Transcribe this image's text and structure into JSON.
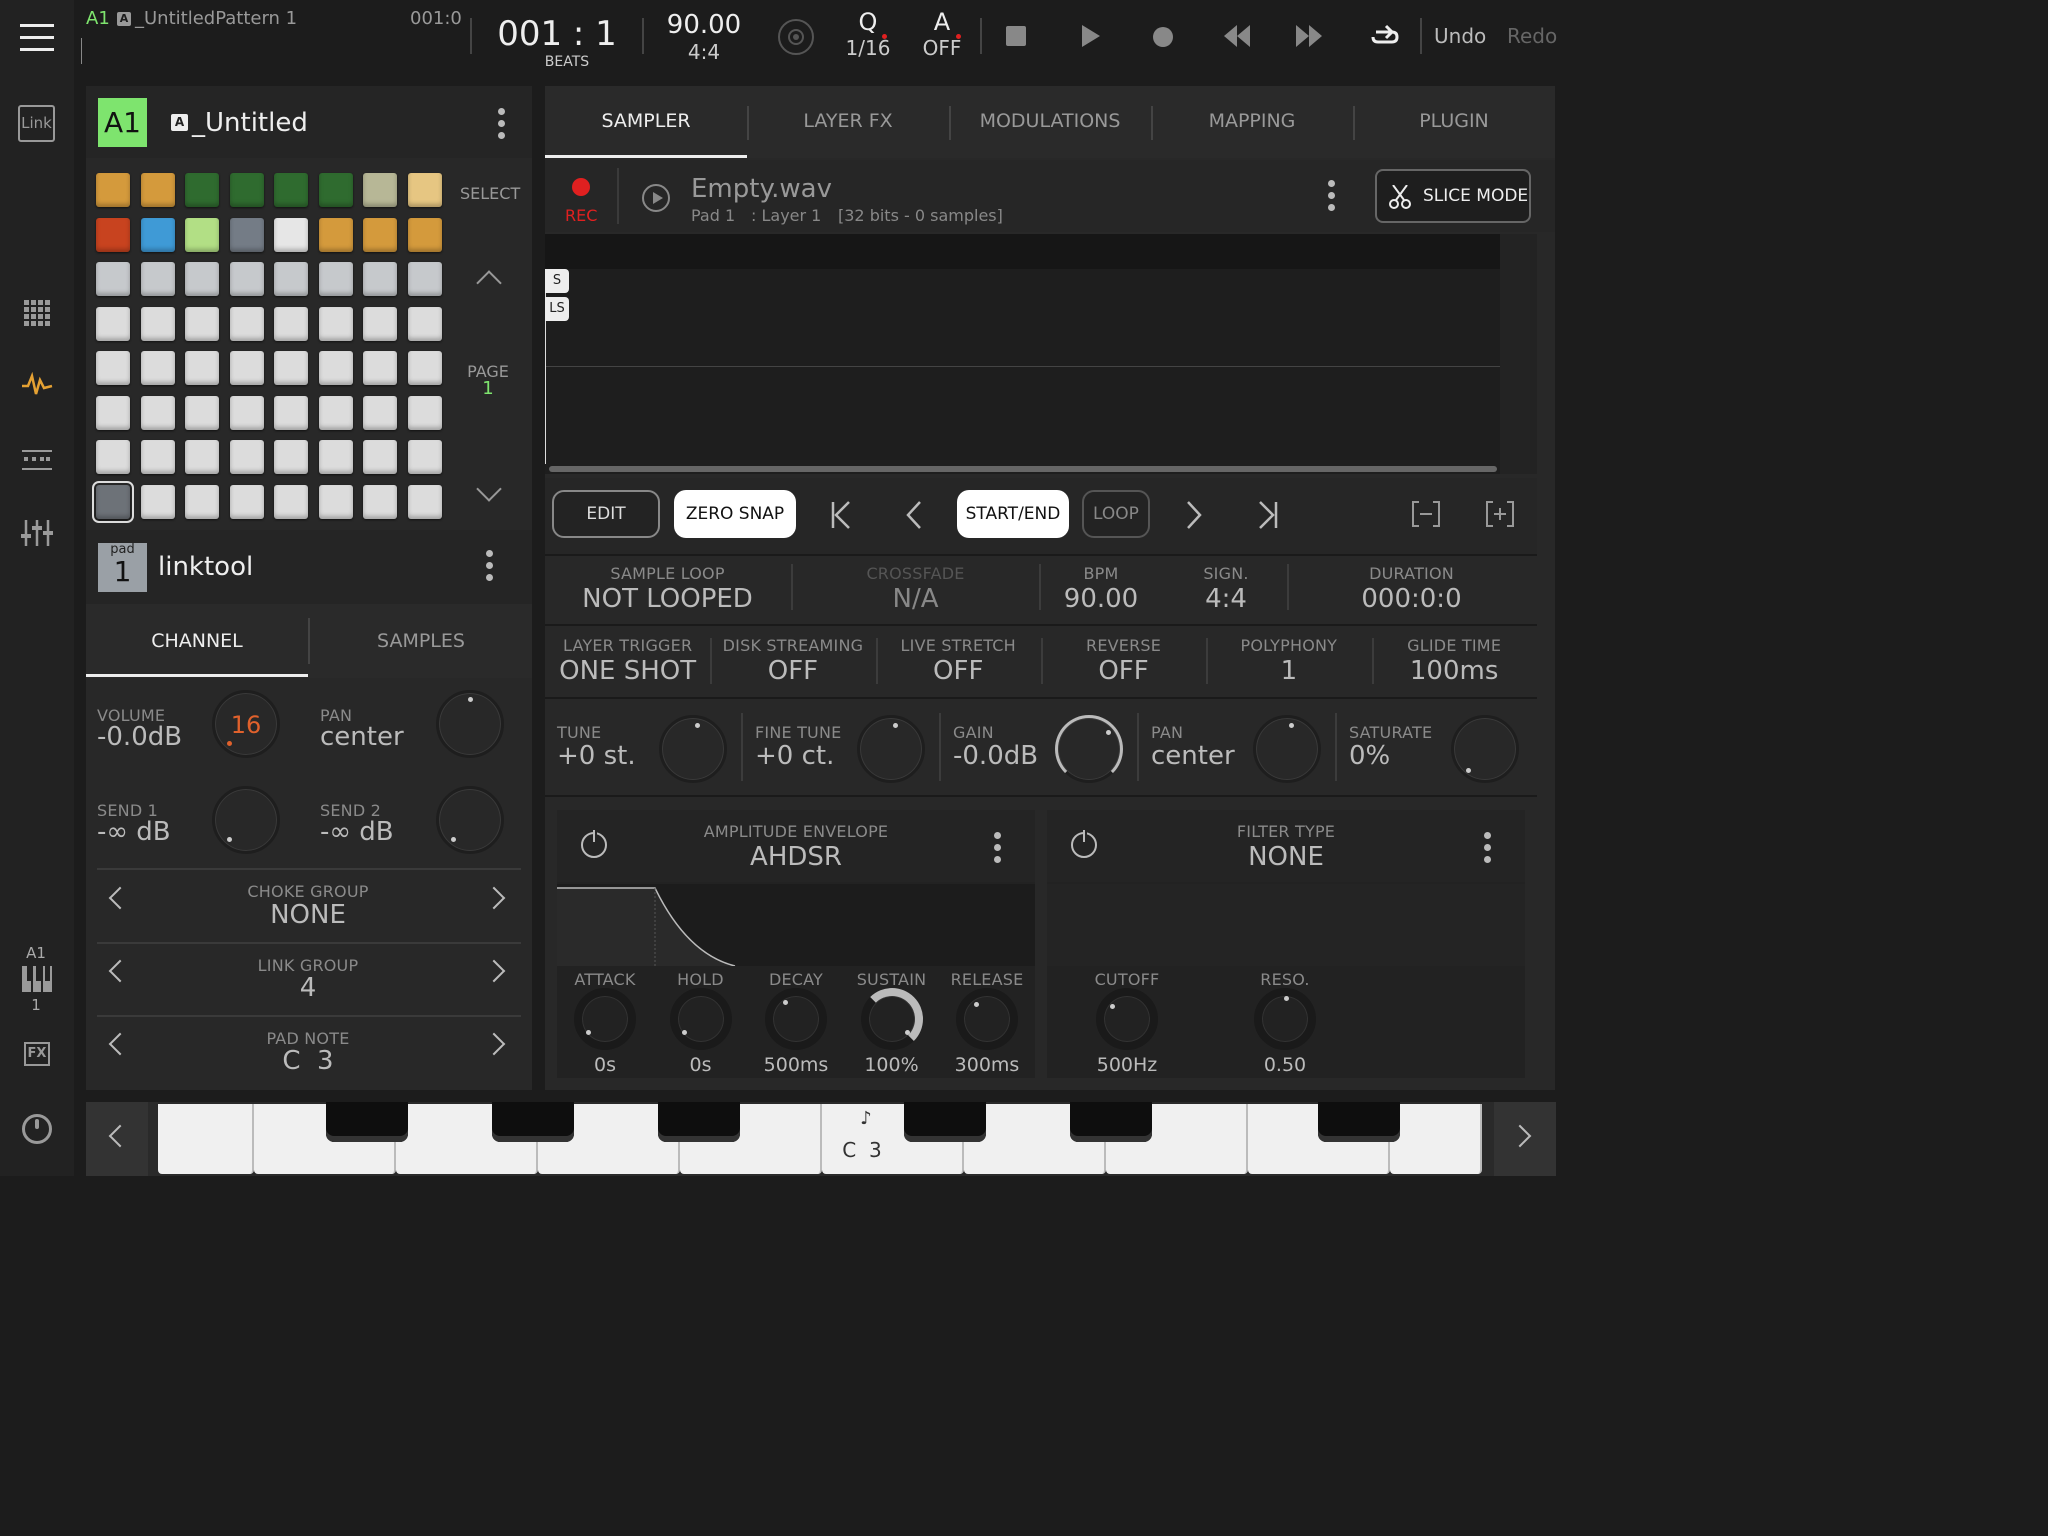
{
  "topbar": {
    "pattern_id": "A1",
    "pattern_badge": "A",
    "pattern_name": "_UntitledPattern 1",
    "position_small": "001:0",
    "position": "001 : 1",
    "position_unit": "BEATS",
    "bpm": "90.00",
    "signature": "4:4",
    "quantize_label": "Q",
    "quantize_value": "1/16",
    "auto_label": "A",
    "auto_value": "OFF",
    "undo": "Undo",
    "redo": "Redo"
  },
  "rail": {
    "link_label": "Link",
    "bank_label": "A1",
    "bank_num": "1",
    "fx_label": "FX"
  },
  "pattern_header": {
    "id": "A1",
    "badge": "A",
    "name": "_Untitled"
  },
  "pad_grid": {
    "select_label": "SELECT",
    "page_label": "PAGE",
    "page_value": "1",
    "rows": [
      [
        "#d49a3c",
        "#d49a3c",
        "#2f6b2f",
        "#2f6b2f",
        "#2f6b2f",
        "#2f6b2f",
        "#b7b796",
        "#e6c682"
      ],
      [
        "#c8431f",
        "#3f9ad6",
        "#b2df85",
        "#747c86",
        "#e6e6e6",
        "#d49a3c",
        "#d49a3c",
        "#d49a3c"
      ],
      [
        "#c6c9cc",
        "#c6c9cc",
        "#c6c9cc",
        "#c6c9cc",
        "#c6c9cc",
        "#c6c9cc",
        "#c6c9cc",
        "#c6c9cc"
      ],
      [
        "#dcdcdc",
        "#dcdcdc",
        "#dcdcdc",
        "#dcdcdc",
        "#dcdcdc",
        "#dcdcdc",
        "#dcdcdc",
        "#dcdcdc"
      ],
      [
        "#dcdcdc",
        "#dcdcdc",
        "#dcdcdc",
        "#dcdcdc",
        "#dcdcdc",
        "#dcdcdc",
        "#dcdcdc",
        "#dcdcdc"
      ],
      [
        "#dcdcdc",
        "#dcdcdc",
        "#dcdcdc",
        "#dcdcdc",
        "#dcdcdc",
        "#dcdcdc",
        "#dcdcdc",
        "#dcdcdc"
      ],
      [
        "#dcdcdc",
        "#dcdcdc",
        "#dcdcdc",
        "#dcdcdc",
        "#dcdcdc",
        "#dcdcdc",
        "#dcdcdc",
        "#dcdcdc"
      ],
      [
        "#6d7278",
        "#dcdcdc",
        "#dcdcdc",
        "#dcdcdc",
        "#dcdcdc",
        "#dcdcdc",
        "#dcdcdc",
        "#dcdcdc"
      ]
    ]
  },
  "pad_info": {
    "pad_label": "pad",
    "pad_num": "1",
    "name": "linktool"
  },
  "left_tabs": {
    "channel": "CHANNEL",
    "samples": "SAMPLES"
  },
  "channel": {
    "volume_label": "VOLUME",
    "volume_value": "-0.0dB",
    "volume_knob_value": "16",
    "pan_label": "PAN",
    "pan_value": "center",
    "send1_label": "SEND 1",
    "send1_value": "-∞ dB",
    "send2_label": "SEND 2",
    "send2_value": "-∞ dB",
    "choke_label": "CHOKE GROUP",
    "choke_value": "NONE",
    "link_label": "LINK GROUP",
    "link_value": "4",
    "note_label": "PAD NOTE",
    "note_value": "C  3"
  },
  "right_tabs": [
    "SAMPLER",
    "LAYER FX",
    "MODULATIONS",
    "MAPPING",
    "PLUGIN"
  ],
  "sample": {
    "rec": "REC",
    "file": "Empty.wav",
    "pad": "Pad 1",
    "layer": ": Layer 1",
    "info": "[32 bits - 0 samples]",
    "slice_mode": "SLICE MODE",
    "marker_s": "S",
    "marker_ls": "LS"
  },
  "edit_bar": {
    "edit": "EDIT",
    "zero_snap": "ZERO SNAP",
    "start_end": "START/END",
    "loop": "LOOP"
  },
  "params1": {
    "sample_loop_label": "SAMPLE LOOP",
    "sample_loop_value": "NOT LOOPED",
    "crossfade_label": "CROSSFADE",
    "crossfade_value": "N/A",
    "bpm_label": "BPM",
    "bpm_value": "90.00",
    "sign_label": "SIGN.",
    "sign_value": "4:4",
    "duration_label": "DURATION",
    "duration_value": "000:0:0"
  },
  "params2": [
    {
      "label": "LAYER TRIGGER",
      "value": "ONE SHOT"
    },
    {
      "label": "DISK STREAMING",
      "value": "OFF"
    },
    {
      "label": "LIVE STRETCH",
      "value": "OFF"
    },
    {
      "label": "REVERSE",
      "value": "OFF"
    },
    {
      "label": "POLYPHONY",
      "value": "1"
    },
    {
      "label": "GLIDE TIME",
      "value": "100ms"
    }
  ],
  "params3": [
    {
      "label": "TUNE",
      "value": "+0 st."
    },
    {
      "label": "FINE TUNE",
      "value": "+0 ct."
    },
    {
      "label": "GAIN",
      "value": "-0.0dB"
    },
    {
      "label": "PAN",
      "value": "center"
    },
    {
      "label": "SATURATE",
      "value": "0%"
    }
  ],
  "amp_env": {
    "title": "AMPLITUDE ENVELOPE",
    "type": "AHDSR",
    "knobs": [
      {
        "label": "ATTACK",
        "value": "0s"
      },
      {
        "label": "HOLD",
        "value": "0s"
      },
      {
        "label": "DECAY",
        "value": "500ms"
      },
      {
        "label": "SUSTAIN",
        "value": "100%"
      },
      {
        "label": "RELEASE",
        "value": "300ms"
      }
    ]
  },
  "filter": {
    "title": "FILTER TYPE",
    "type": "NONE",
    "knobs": [
      {
        "label": "CUTOFF",
        "value": "500Hz"
      },
      {
        "label": "RESO.",
        "value": "0.50"
      }
    ]
  },
  "keyboard": {
    "note_icon": "♪",
    "note": "C  3"
  },
  "colors": {
    "accent": "#7ee46e",
    "rec": "#e02020",
    "volume": "#e0612c",
    "amber_icon": "#e5a133"
  }
}
